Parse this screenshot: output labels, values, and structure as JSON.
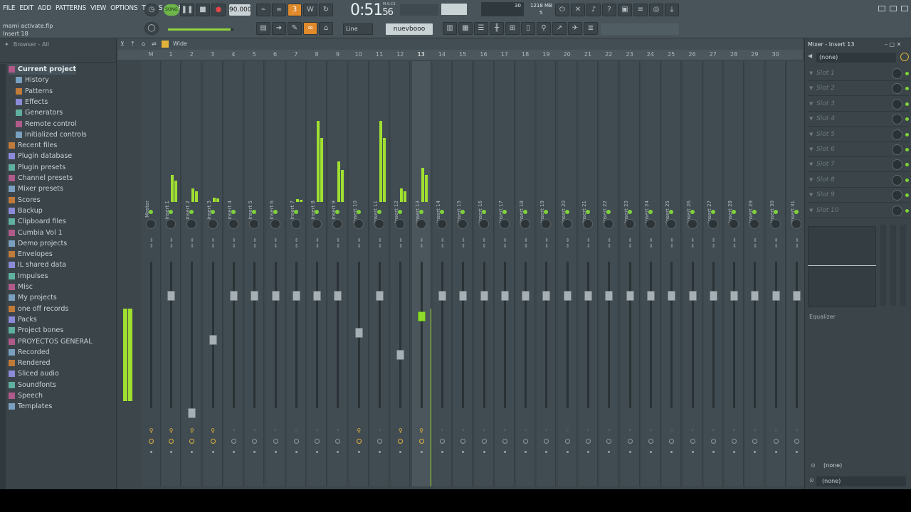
{
  "menu": [
    "FILE",
    "EDIT",
    "ADD",
    "PATTERNS",
    "VIEW",
    "OPTIONS",
    "TOOLS",
    "HELP"
  ],
  "project_file": "mami activate.flp",
  "hint_text": "Insert 18",
  "song_mode": "SONG",
  "tempo": "90.000",
  "time": "0:51",
  "time_sub": "56",
  "time_label": "M:S:CS",
  "cpu": "30",
  "ram": "1218 MB",
  "polyphony": "5",
  "snap": "Line",
  "pattern": "nuevbooo",
  "browser": {
    "header": "Browser - All",
    "items": [
      {
        "label": "Current project",
        "level": 0,
        "root": true
      },
      {
        "label": "History",
        "level": 1
      },
      {
        "label": "Patterns",
        "level": 1
      },
      {
        "label": "Effects",
        "level": 1
      },
      {
        "label": "Generators",
        "level": 1
      },
      {
        "label": "Remote control",
        "level": 1
      },
      {
        "label": "Initialized controls",
        "level": 1
      },
      {
        "label": "Recent files",
        "level": 0
      },
      {
        "label": "Plugin database",
        "level": 0
      },
      {
        "label": "Plugin presets",
        "level": 0
      },
      {
        "label": "Channel presets",
        "level": 0
      },
      {
        "label": "Mixer presets",
        "level": 0
      },
      {
        "label": "Scores",
        "level": 0
      },
      {
        "label": "Backup",
        "level": 0
      },
      {
        "label": "Clipboard files",
        "level": 0
      },
      {
        "label": "Cumbia Vol 1",
        "level": 0
      },
      {
        "label": "Demo projects",
        "level": 0
      },
      {
        "label": "Envelopes",
        "level": 0
      },
      {
        "label": "IL shared data",
        "level": 0
      },
      {
        "label": "Impulses",
        "level": 0
      },
      {
        "label": "Misc",
        "level": 0
      },
      {
        "label": "My projects",
        "level": 0
      },
      {
        "label": "one off records",
        "level": 0
      },
      {
        "label": "Packs",
        "level": 0
      },
      {
        "label": "Project bones",
        "level": 0
      },
      {
        "label": "PROYECTOS GENERAL",
        "level": 0
      },
      {
        "label": "Recorded",
        "level": 0
      },
      {
        "label": "Rendered",
        "level": 0
      },
      {
        "label": "Sliced audio",
        "level": 0
      },
      {
        "label": "Soundfonts",
        "level": 0
      },
      {
        "label": "Speech",
        "level": 0
      },
      {
        "label": "Templates",
        "level": 0
      }
    ]
  },
  "mixer": {
    "view_mode": "Wide",
    "selected_index": 13,
    "strips": [
      {
        "name": "Master",
        "num": "M",
        "level": 0.6,
        "fader": 0.8,
        "route": true
      },
      {
        "name": "Insert 1",
        "num": "1",
        "level": 0.2,
        "fader": 0.8,
        "route": true
      },
      {
        "name": "Insert 2",
        "num": "2",
        "level": 0.1,
        "fader": 0.0,
        "route": true
      },
      {
        "name": "Insert 3",
        "num": "3",
        "level": 0.03,
        "fader": 0.5,
        "route": true
      },
      {
        "name": "Insert 4",
        "num": "4",
        "level": 0,
        "fader": 0.8,
        "route": false
      },
      {
        "name": "Insert 5",
        "num": "5",
        "level": 0,
        "fader": 0.8,
        "route": false
      },
      {
        "name": "Insert 6",
        "num": "6",
        "level": 0,
        "fader": 0.8,
        "route": false
      },
      {
        "name": "Insert 7",
        "num": "7",
        "level": 0.02,
        "fader": 0.8,
        "route": false
      },
      {
        "name": "Insert 8",
        "num": "8",
        "level": 0.6,
        "fader": 0.8,
        "route": false
      },
      {
        "name": "Insert 9",
        "num": "9",
        "level": 0.3,
        "fader": 0.8,
        "route": false
      },
      {
        "name": "Insert 10",
        "num": "10",
        "level": 0,
        "fader": 0.55,
        "route": true
      },
      {
        "name": "Insert 11",
        "num": "11",
        "level": 0.6,
        "fader": 0.8,
        "route": false
      },
      {
        "name": "Insert 12",
        "num": "12",
        "level": 0.1,
        "fader": 0.4,
        "route": true
      },
      {
        "name": "Insert 13",
        "num": "13",
        "level": 0.25,
        "fader": 0.66,
        "route": true
      },
      {
        "name": "Insert 14",
        "num": "14",
        "level": 0,
        "fader": 0.8,
        "route": false
      },
      {
        "name": "Insert 15",
        "num": "15",
        "level": 0,
        "fader": 0.8,
        "route": false
      },
      {
        "name": "Insert 16",
        "num": "16",
        "level": 0,
        "fader": 0.8,
        "route": false
      },
      {
        "name": "Insert 17",
        "num": "17",
        "level": 0,
        "fader": 0.8,
        "route": false
      },
      {
        "name": "Insert 18",
        "num": "18",
        "level": 0,
        "fader": 0.8,
        "route": false
      },
      {
        "name": "Insert 19",
        "num": "19",
        "level": 0,
        "fader": 0.8,
        "route": false
      },
      {
        "name": "Insert 20",
        "num": "20",
        "level": 0,
        "fader": 0.8,
        "route": false
      },
      {
        "name": "Insert 21",
        "num": "21",
        "level": 0,
        "fader": 0.8,
        "route": false
      },
      {
        "name": "Insert 22",
        "num": "22",
        "level": 0,
        "fader": 0.8,
        "route": false
      },
      {
        "name": "Insert 23",
        "num": "23",
        "level": 0,
        "fader": 0.8,
        "route": false
      },
      {
        "name": "Insert 24",
        "num": "24",
        "level": 0,
        "fader": 0.8,
        "route": false
      },
      {
        "name": "Insert 25",
        "num": "25",
        "level": 0,
        "fader": 0.8,
        "route": false
      },
      {
        "name": "Insert 26",
        "num": "26",
        "level": 0,
        "fader": 0.8,
        "route": false
      },
      {
        "name": "Insert 27",
        "num": "27",
        "level": 0,
        "fader": 0.8,
        "route": false
      },
      {
        "name": "Insert 28",
        "num": "28",
        "level": 0,
        "fader": 0.8,
        "route": false
      },
      {
        "name": "Insert 29",
        "num": "29",
        "level": 0,
        "fader": 0.8,
        "route": false
      },
      {
        "name": "Insert 30",
        "num": "30",
        "level": 0,
        "fader": 0.8,
        "route": false
      },
      {
        "name": "Insert 31",
        "num": "",
        "level": 0,
        "fader": 0.8,
        "route": false
      }
    ]
  },
  "insert_panel": {
    "title": "Mixer - Insert 13",
    "preset": "(none)",
    "slots": [
      "Slot 1",
      "Slot 2",
      "Slot 3",
      "Slot 4",
      "Slot 5",
      "Slot 6",
      "Slot 7",
      "Slot 8",
      "Slot 9",
      "Slot 10"
    ],
    "eq_label": "Equalizer",
    "output_1": "(none)",
    "output_2": "(none)"
  },
  "colors": {
    "accent": "#9fe030",
    "active_orange": "#e08a2c",
    "background": "#3b454a"
  }
}
